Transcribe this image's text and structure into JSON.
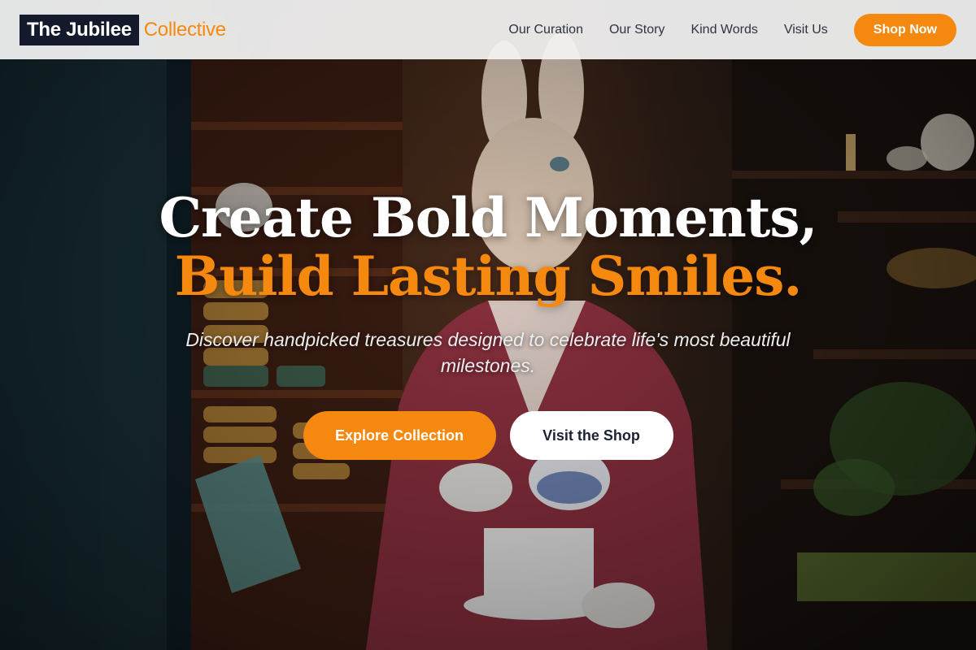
{
  "brand": {
    "name_main": "The Jubilee",
    "name_accent": "Collective"
  },
  "nav": {
    "links": [
      "Our Curation",
      "Our Story",
      "Kind Words",
      "Visit Us"
    ],
    "cta_label": "Shop Now"
  },
  "hero": {
    "headline_line1": "Create Bold Moments,",
    "headline_line2": "Build Lasting Smiles.",
    "subtitle": "Discover handpicked treasures designed to celebrate life's most beautiful milestones.",
    "primary_button": "Explore Collection",
    "secondary_button": "Visit the Shop",
    "background_image": "shop-interior-rabbit-statue-photo"
  },
  "colors": {
    "accent": "#f5880f",
    "brand_dark": "#141a2c",
    "nav_background": "#f4f4f4",
    "text_dark": "#2f3340"
  }
}
